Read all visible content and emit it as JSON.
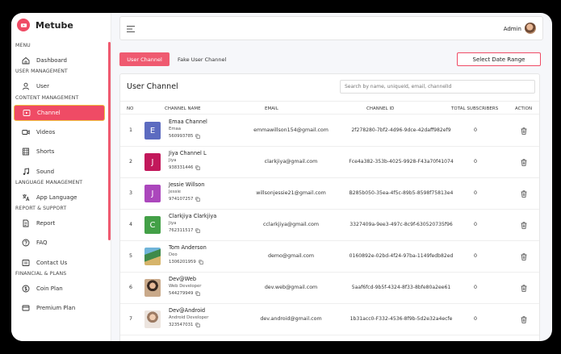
{
  "app": {
    "name": "Metube"
  },
  "sidebar": {
    "sections": [
      {
        "label": "MENU",
        "items": [
          {
            "label": "Dashboard",
            "icon": "home-icon"
          }
        ]
      },
      {
        "label": "USER MANAGEMENT",
        "items": [
          {
            "label": "User",
            "icon": "user-icon"
          }
        ]
      },
      {
        "label": "CONTENT MANAGEMENT",
        "items": [
          {
            "label": "Channel",
            "icon": "play-square-icon",
            "active": true
          },
          {
            "label": "Videos",
            "icon": "video-icon"
          },
          {
            "label": "Shorts",
            "icon": "film-icon"
          },
          {
            "label": "Sound",
            "icon": "music-icon"
          }
        ]
      },
      {
        "label": "LANGUAGE MANAGEMENT",
        "items": [
          {
            "label": "App Language",
            "icon": "translate-icon"
          }
        ]
      },
      {
        "label": "REPORT & SUPPORT",
        "items": [
          {
            "label": "Report",
            "icon": "report-icon"
          },
          {
            "label": "FAQ",
            "icon": "question-icon"
          },
          {
            "label": "Contact Us",
            "icon": "contact-icon"
          }
        ]
      },
      {
        "label": "FINANCIAL & PLANS",
        "items": [
          {
            "label": "Coin Plan",
            "icon": "coin-icon"
          },
          {
            "label": "Premium Plan",
            "icon": "premium-icon"
          }
        ]
      }
    ]
  },
  "topbar": {
    "user_label": "Admin"
  },
  "tabs": {
    "active": "User Channel",
    "inactive": "Fake User Channel"
  },
  "date_button": "Select Date Range",
  "card": {
    "title": "User Channel",
    "search_placeholder": "Search by name, uniqueId, email, channelId"
  },
  "table": {
    "headers": [
      "NO",
      "CHANNEL NAME",
      "EMAIL",
      "CHANNEL ID",
      "TOTAL SUBSCRIBERS",
      "ACTION"
    ],
    "rows": [
      {
        "no": "1",
        "name": "Emaa Channel",
        "sub": "Emaa",
        "id": "560993785",
        "email": "emmawillson154@gmail.com",
        "channel_id": "2f278280-7bf2-4d96-9dce-42daff982ef9",
        "subs": "0",
        "avatar": {
          "type": "letter",
          "letter": "E",
          "color": "#5c6bc0"
        }
      },
      {
        "no": "2",
        "name": "Jiya Channel L",
        "sub": "Jiya",
        "id": "938331446",
        "email": "clarkjiya@gmail.com",
        "channel_id": "Fce4a382-353b-4025-9928-F43a70f41074",
        "subs": "0",
        "avatar": {
          "type": "letter",
          "letter": "J",
          "color": "#c2185b"
        }
      },
      {
        "no": "3",
        "name": "Jessie Willson",
        "sub": "Jessie",
        "id": "974107257",
        "email": "willsonjessie21@gmail.com",
        "channel_id": "B285b050-35ea-4f5c-89b5-8598f75813e4",
        "subs": "0",
        "avatar": {
          "type": "letter",
          "letter": "J",
          "color": "#ab47bc"
        }
      },
      {
        "no": "4",
        "name": "Clarkjiya Clarkjiya",
        "sub": "Jiya",
        "id": "762311517",
        "email": "cclarkjiya@gmail.com",
        "channel_id": "3327409a-9ee3-497c-8c9f-630520735f96",
        "subs": "0",
        "avatar": {
          "type": "letter",
          "letter": "C",
          "color": "#43a047"
        }
      },
      {
        "no": "5",
        "name": "Tom Anderson",
        "sub": "Deo",
        "id": "1306201959",
        "email": "demo@gmail.com",
        "channel_id": "0160892e-02bd-4f24-97ba-1149fedb82ed",
        "subs": "0",
        "avatar": {
          "type": "photo",
          "style": "landscape"
        }
      },
      {
        "no": "6",
        "name": "Dev@Web",
        "sub": "Web Developer",
        "id": "544279949",
        "email": "dev.web@gmail.com",
        "channel_id": "5aaf6fcd-9b5f-4324-8f33-8bfe80a2ee61",
        "subs": "0",
        "avatar": {
          "type": "photo",
          "style": "person-dark"
        }
      },
      {
        "no": "7",
        "name": "Dev@Android",
        "sub": "Android Developer",
        "id": "323547031",
        "email": "dev.android@gmail.com",
        "channel_id": "1b31acc0-F332-4536-8f9b-5d2e32a4ecfe",
        "subs": "0",
        "avatar": {
          "type": "photo",
          "style": "person-light"
        }
      }
    ]
  },
  "colors": {
    "accent": "#ef4b65",
    "active_border": "#f0c040"
  }
}
